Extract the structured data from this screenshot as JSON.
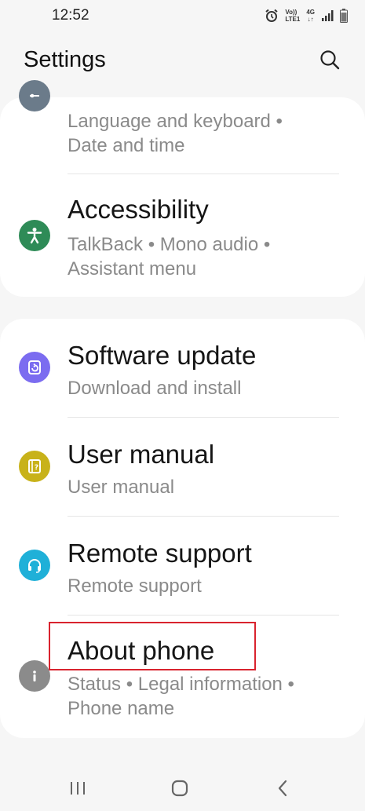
{
  "status_bar": {
    "time": "12:52",
    "volte_top": "Vo))",
    "volte_bottom": "LTE1",
    "net_top": "4G",
    "net_bottom": "↓↑",
    "icons": [
      "alarm-icon",
      "signal-icon",
      "battery-icon"
    ]
  },
  "header": {
    "title": "Settings",
    "search_icon": "search-icon"
  },
  "card1": {
    "partial_item": {
      "icon": "general-management-icon",
      "sub_line1": "Language and keyboard  •",
      "sub_line2": "Date and time"
    },
    "accessibility": {
      "title": "Accessibility",
      "sub_line1": "TalkBack  •  Mono audio  •",
      "sub_line2": "Assistant menu",
      "icon": "accessibility-icon",
      "icon_color": "#2e8b57"
    }
  },
  "card2": {
    "items": [
      {
        "title": "Software update",
        "sub": "Download and install",
        "icon": "software-update-icon",
        "icon_color": "#7b6cf0"
      },
      {
        "title": "User manual",
        "sub": "User manual",
        "icon": "user-manual-icon",
        "icon_color": "#c8b21a"
      },
      {
        "title": "Remote support",
        "sub": "Remote support",
        "icon": "headset-icon",
        "icon_color": "#1fb0d8"
      },
      {
        "title": "About phone",
        "sub_line1": "Status  •  Legal information  •",
        "sub_line2": "Phone name",
        "icon": "info-icon",
        "icon_color": "#8b8b8b"
      }
    ]
  },
  "nav": {
    "recents": "recents-icon",
    "home": "home-icon",
    "back": "back-icon"
  },
  "annotation_color": "#d9232e"
}
